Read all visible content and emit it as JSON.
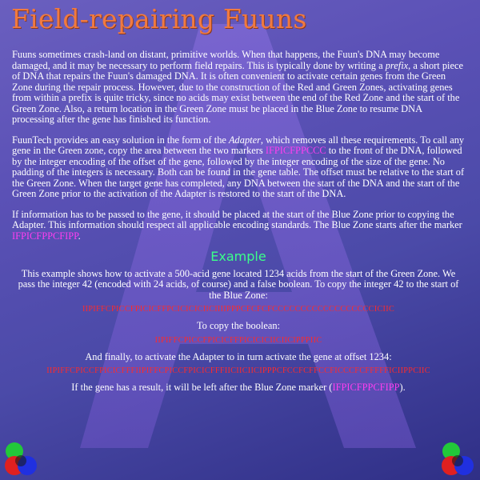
{
  "title": "Field-repairing Fuuns",
  "paragraphs": {
    "p1": "Fuuns sometimes crash-land on distant, primitive worlds. When that happens, the Fuun's DNA may become damaged, and it may be necessary to perform field repairs. This is typically done by writing a ",
    "p1_em": "prefix",
    "p1_rest": ", a short piece of DNA that repairs the Fuun's damaged DNA.  It is often convenient to activate certain genes from the Green Zone during the repair process. However, due to the construction of the Red and Green Zones, activating genes from within a prefix is quite tricky, since no acids may exist between the end of the Red Zone and the start of the Green Zone.  Also, a return location in the Green Zone must be placed in the Blue Zone to resume DNA processing after the gene has finished its function.",
    "p2_a": "FuunTech provides an easy solution in the form of the ",
    "p2_em": "Adapter",
    "p2_b": ", which removes all these requirements. To call any gene in the Green zone, copy the area between the two markers ",
    "p2_marker": "IFPICFPPCCC",
    "p2_c": " to the front of the DNA, followed by the integer encoding of the offset of the gene, followed by the integer encoding of the size of the gene.  No padding of the integers is necessary.  Both can be found in the gene table. The offset must be relative to the start of the Green Zone.  When the target gene has completed, any DNA between the start of the DNA and the start of the Green Zone prior to the activation of the Adapter is restored to the start of the DNA.",
    "p3_a": "If information has to be passed to the gene, it should be placed at the start of the Blue Zone prior to copying the Adapter.  This information should respect all applicable encoding standards.  The Blue Zone starts after the marker ",
    "p3_marker": "IFPICFPPCFIPP",
    "p3_b": "."
  },
  "example": {
    "heading": "Example",
    "intro": "This example shows how to activate a 500-acid gene located 1234 acids from the start of the Green Zone.  We pass the integer 42 (encoded with 24 acids, of course) and a false boolean.  To copy the integer 42 to the start of the Blue Zone:",
    "code1": "IIPIFFCPICCFPICICFFPCICICICIICIIIIPPPCFCFCFCCCCCCCCCCCCCCCCCCICIIC",
    "bool_label": "To copy the boolean:",
    "code2": "IIPIFFCPICCFPICICFFPICICICIICIICIPPPIIC",
    "adapter_label": "And finally, to activate the Adapter to in turn activate the gene at offset 1234:",
    "code3": "IIPIFFCPICCFPICICFFFIIPIFFCPICCFPICICFFFIICIICIICIPPPCFCCFCFFCCFICCCFCFFFFFICIIPPCIIC",
    "result_a": "If the gene has a result, it will be left after the Blue Zone marker (",
    "result_marker": "IFPICFPPCFIPP",
    "result_b": ")."
  },
  "colors": {
    "title": "#f07a40",
    "marker": "#ff3df0",
    "code": "#ff2a2a",
    "example_heading": "#3cff8a"
  },
  "icons": [
    "background-letter-a-glyph",
    "rgb-circles-logo-icon"
  ]
}
